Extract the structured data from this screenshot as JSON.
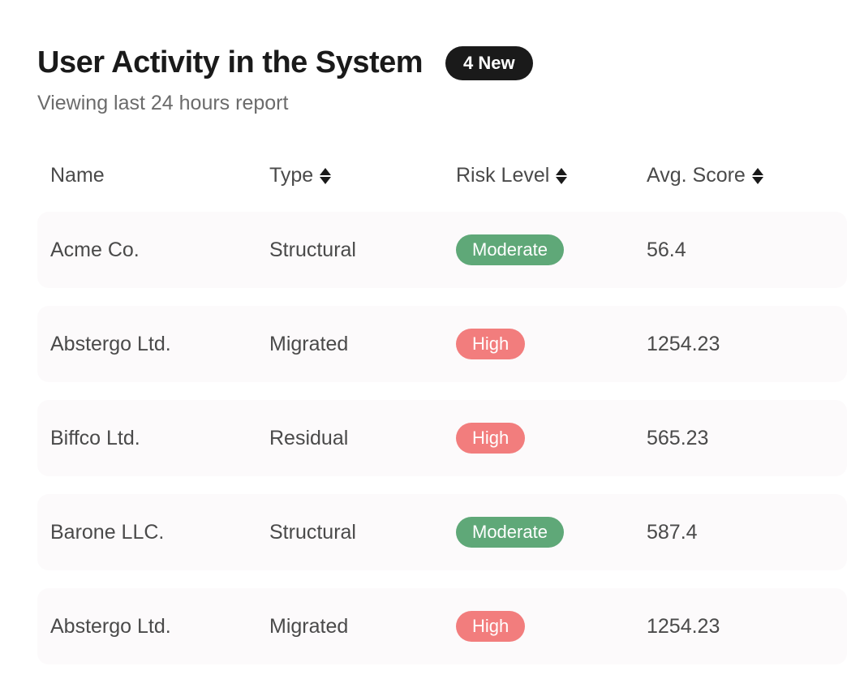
{
  "header": {
    "title": "User Activity in the System",
    "badge": "4 New",
    "subtitle": "Viewing last 24 hours report"
  },
  "table": {
    "columns": {
      "name": "Name",
      "type": "Type",
      "risk": "Risk Level",
      "score": "Avg. Score"
    },
    "rows": [
      {
        "name": "Acme Co.",
        "type": "Structural",
        "risk": "Moderate",
        "risk_level": "moderate",
        "score": "56.4"
      },
      {
        "name": "Abstergo Ltd.",
        "type": "Migrated",
        "risk": "High",
        "risk_level": "high",
        "score": "1254.23"
      },
      {
        "name": "Biffco  Ltd.",
        "type": "Residual",
        "risk": "High",
        "risk_level": "high",
        "score": "565.23"
      },
      {
        "name": "Barone LLC.",
        "type": "Structural",
        "risk": "Moderate",
        "risk_level": "moderate",
        "score": "587.4"
      },
      {
        "name": "Abstergo Ltd.",
        "type": "Migrated",
        "risk": "High",
        "risk_level": "high",
        "score": "1254.23"
      }
    ]
  },
  "colors": {
    "moderate": "#5fa878",
    "high": "#f27d7d",
    "badge_bg": "#1a1a1a"
  }
}
